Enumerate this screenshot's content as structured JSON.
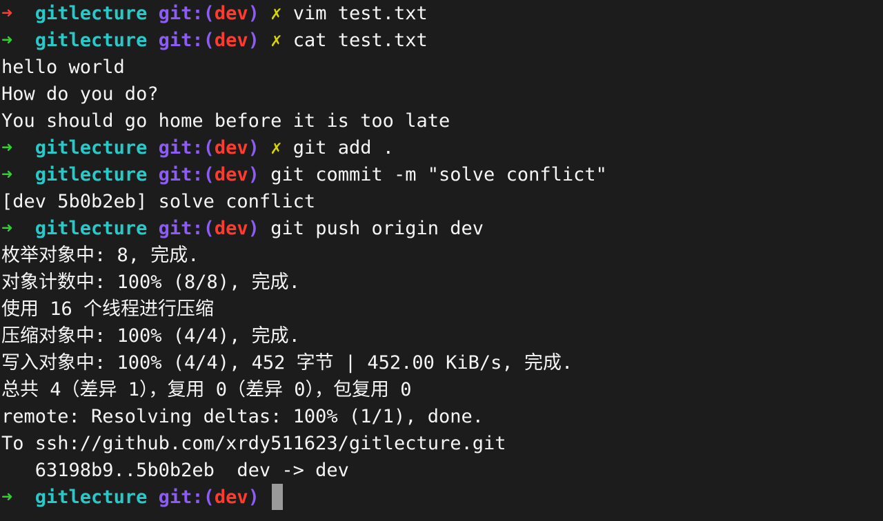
{
  "prompt": {
    "dir": "gitlecture",
    "git_prefix": "git:(",
    "branch": "dev",
    "git_suffix": ")",
    "arrow": "➜",
    "dirty_mark": "✗"
  },
  "commands": [
    {
      "arrow_status": "error",
      "dirty": true,
      "text": "vim test.txt"
    },
    {
      "arrow_status": "ok",
      "dirty": true,
      "text": "cat test.txt"
    },
    {
      "arrow_status": "ok",
      "dirty": true,
      "text": "git add ."
    },
    {
      "arrow_status": "ok",
      "dirty": false,
      "text": "git commit -m \"solve conflict\""
    },
    {
      "arrow_status": "ok",
      "dirty": false,
      "text": "git push origin dev"
    }
  ],
  "output": {
    "cat": [
      "hello world",
      "How do you do?",
      "You should go home before it is too late"
    ],
    "commit": [
      "[dev 5b0b2eb] solve conflict"
    ],
    "push": [
      "枚举对象中: 8, 完成.",
      "对象计数中: 100% (8/8), 完成.",
      "使用 16 个线程进行压缩",
      "压缩对象中: 100% (4/4), 完成.",
      "写入对象中: 100% (4/4), 452 字节 | 452.00 KiB/s, 完成.",
      "总共 4（差异 1），复用 0（差异 0），包复用 0",
      "remote: Resolving deltas: 100% (1/1), done.",
      "To ssh://github.com/xrdy511623/gitlecture.git",
      "   63198b9..5b0b2eb  dev -> dev"
    ]
  },
  "colors": {
    "background": "#1c1c1c",
    "text": "#f5f5f5",
    "arrow_ok": "#2fd12f",
    "arrow_error": "#ff3b30",
    "dir": "#27c9c9",
    "git": "#8c5cf5",
    "branch": "#ff3b30",
    "dirty": "#d6d600",
    "cursor": "#9a9a9a"
  }
}
